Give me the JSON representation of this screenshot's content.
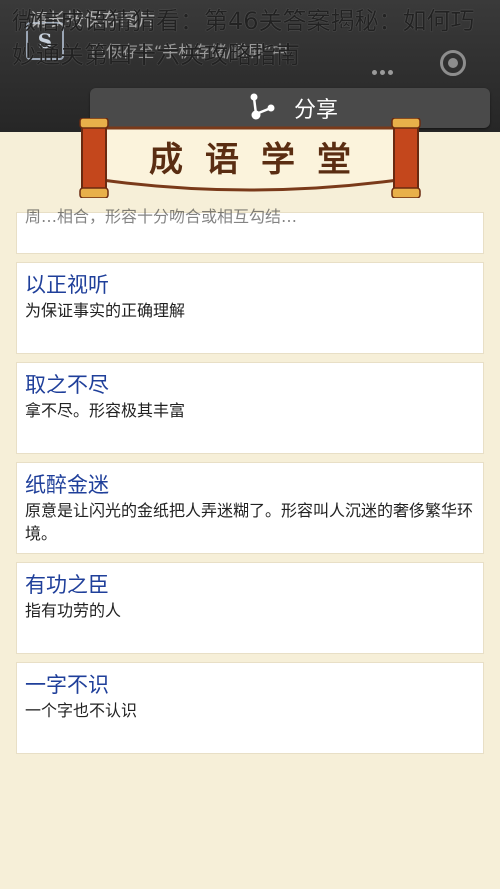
{
  "overlay": {
    "title": "微信成语猜猜看：第46关答案揭秘：如何巧妙通关第四十六关攻略指南",
    "toast_title": "请长按保存图片",
    "toast_sub": "已保存至“手机存储/截屏”中"
  },
  "share": {
    "label": "分享"
  },
  "banner": {
    "text": "成语学堂"
  },
  "partial_card": {
    "desc": "周…相合，形容十分吻合或相互勾结…"
  },
  "cards": [
    {
      "title": "以正视听",
      "desc": "为保证事实的正确理解"
    },
    {
      "title": "取之不尽",
      "desc": "拿不尽。形容极其丰富"
    },
    {
      "title": "纸醉金迷",
      "desc": "原意是让闪光的金纸把人弄迷糊了。形容叫人沉迷的奢侈繁华环境。"
    },
    {
      "title": "有功之臣",
      "desc": "指有功劳的人"
    },
    {
      "title": "一字不识",
      "desc": "一个字也不认识"
    }
  ],
  "colors": {
    "accent": "#1f3f9a",
    "background": "#f6efd8",
    "banner_red": "#c4471c"
  }
}
